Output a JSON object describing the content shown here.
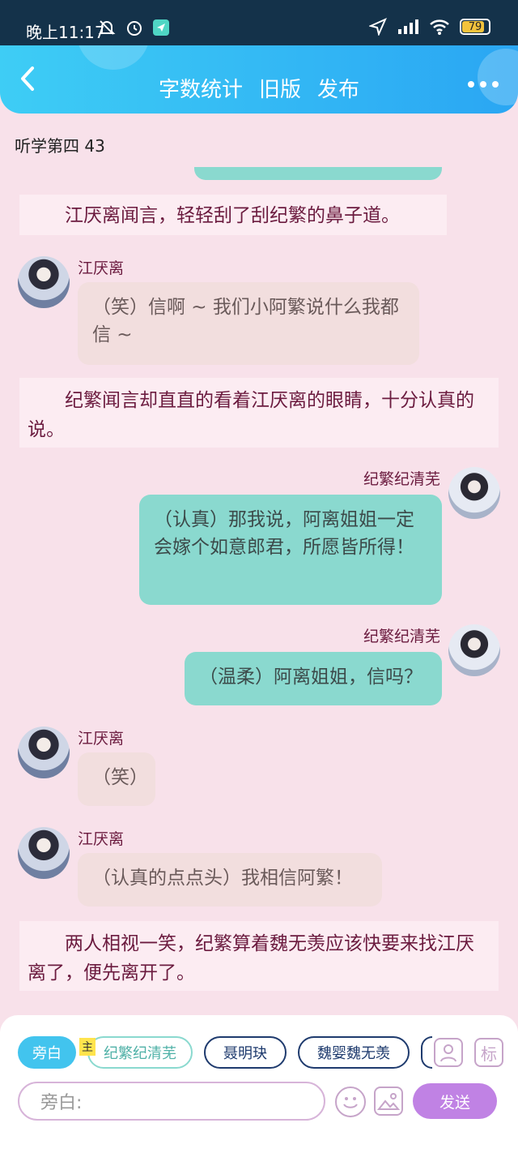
{
  "status_bar": {
    "time": "晚上11:17",
    "battery": "79"
  },
  "header": {
    "menu": [
      "字数统计",
      "旧版",
      "发布"
    ]
  },
  "chapter_title": "听学第四 43",
  "messages": [
    {
      "type": "narration",
      "text": "江厌离闻言，轻轻刮了刮纪繁的鼻子道。"
    },
    {
      "type": "left",
      "name": "江厌离",
      "text": "（笑）信啊 ~ 我们小阿繁说什么我都信 ~"
    },
    {
      "type": "narration",
      "text": "纪繁闻言却直直的看着江厌离的眼睛，十分认真的说。"
    },
    {
      "type": "right",
      "name": "纪繁纪清芜",
      "text": "（认真）那我说，阿离姐姐一定会嫁个如意郎君，所愿皆所得！"
    },
    {
      "type": "right",
      "name": "纪繁纪清芜",
      "text": "（温柔）阿离姐姐，信吗？"
    },
    {
      "type": "left",
      "name": "江厌离",
      "text": "（笑）"
    },
    {
      "type": "left",
      "name": "江厌离",
      "text": "（认真的点点头）我相信阿繁！"
    },
    {
      "type": "narration",
      "text": "两人相视一笑，纪繁算着魏无羡应该快要来找江厌离了，便先离开了。"
    }
  ],
  "composer": {
    "roles": [
      "旁白",
      "纪繁纪清芜",
      "聂明玦",
      "魏婴魏无羡"
    ],
    "main_badge": "主",
    "tag_icon": "标",
    "input_placeholder": "旁白:",
    "send_label": "发送"
  },
  "colors": {
    "header_gradient": [
      "#3ecdf5",
      "#2aa6f3"
    ],
    "background": "#f8e1ea",
    "right_bubble": "#8ad9cf",
    "left_bubble": "#f2dede",
    "send_button": "#c082e4"
  }
}
